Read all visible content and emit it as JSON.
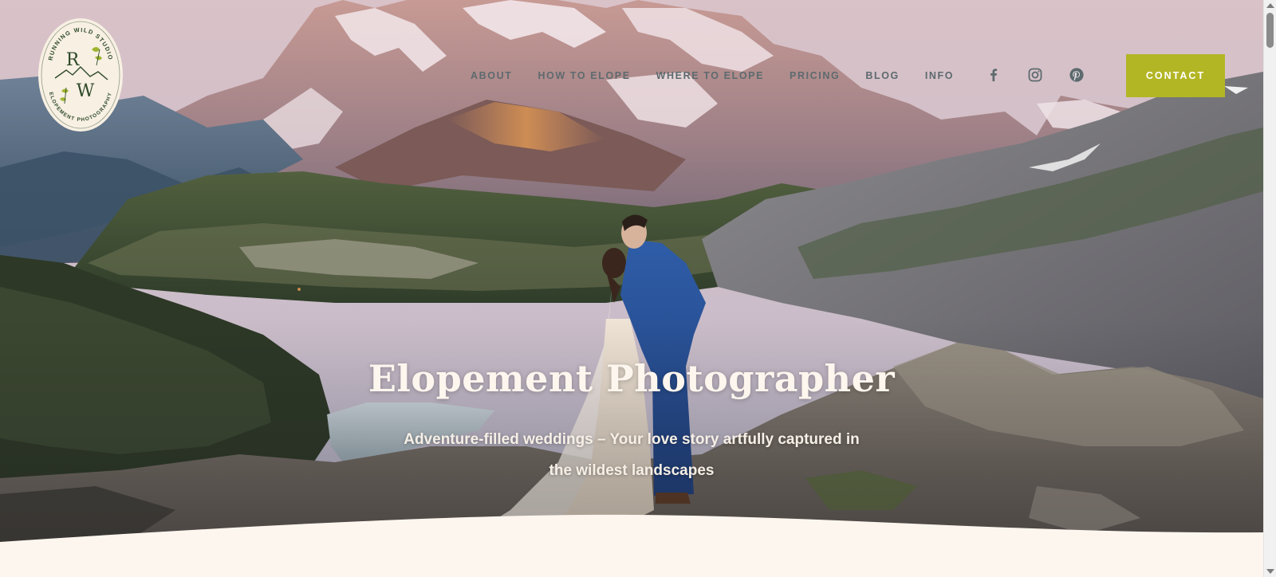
{
  "brand": {
    "logo_top_text": "RUNNING WILD STUDIO",
    "logo_bottom_text": "ELOPEMENT PHOTOGRAPHY",
    "logo_letter_1": "R",
    "logo_letter_2": "W",
    "logo_icon": "mountain-leaf-emblem"
  },
  "nav": {
    "items": [
      {
        "label": "ABOUT"
      },
      {
        "label": "HOW TO ELOPE"
      },
      {
        "label": "WHERE TO ELOPE"
      },
      {
        "label": "PRICING"
      },
      {
        "label": "BLOG"
      },
      {
        "label": "INFO"
      }
    ],
    "social": [
      {
        "icon": "facebook-icon"
      },
      {
        "icon": "instagram-icon"
      },
      {
        "icon": "pinterest-icon"
      }
    ],
    "contact_label": "CONTACT"
  },
  "hero": {
    "title": "Elopement Photographer",
    "subtitle": "Adventure-filled weddings – Your love story artfully captured in the wildest landscapes",
    "image_description": "couple-kissing-on-mountain-ridge"
  },
  "colors": {
    "accent": "#b3b624",
    "nav_text": "#5d6a6e",
    "page_background": "#fdf6ee",
    "logo_green": "#2f4a2a"
  }
}
